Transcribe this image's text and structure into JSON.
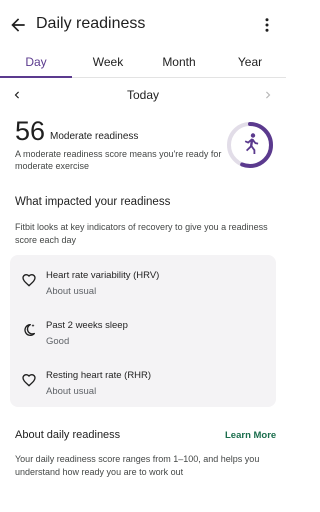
{
  "header": {
    "title": "Daily readiness"
  },
  "tabs": [
    {
      "label": "Day",
      "active": true
    },
    {
      "label": "Week",
      "active": false
    },
    {
      "label": "Month",
      "active": false
    },
    {
      "label": "Year",
      "active": false
    }
  ],
  "date_nav": {
    "label": "Today"
  },
  "score": {
    "value": "56",
    "label": "Moderate readiness",
    "description": "A moderate readiness score means you're ready for moderate exercise",
    "gauge_fraction": 0.56
  },
  "impact": {
    "title": "What impacted your readiness",
    "description": "Fitbit looks at key indicators of recovery to give you a readiness score each day",
    "items": [
      {
        "title": "Heart rate variability (HRV)",
        "status": "About usual",
        "icon": "heart-icon"
      },
      {
        "title": "Past 2 weeks sleep",
        "status": "Good",
        "icon": "moon-icon"
      },
      {
        "title": "Resting heart rate (RHR)",
        "status": "About usual",
        "icon": "heart-icon"
      }
    ]
  },
  "about": {
    "title": "About daily readiness",
    "link": "Learn More",
    "description": "Your daily readiness score ranges from 1–100, and helps you understand how ready you are to work out"
  },
  "colors": {
    "accent": "#5b3a8e",
    "link": "#1b6e4d",
    "card_bg": "#f4f3f5",
    "gauge_track": "#e2dde8"
  }
}
